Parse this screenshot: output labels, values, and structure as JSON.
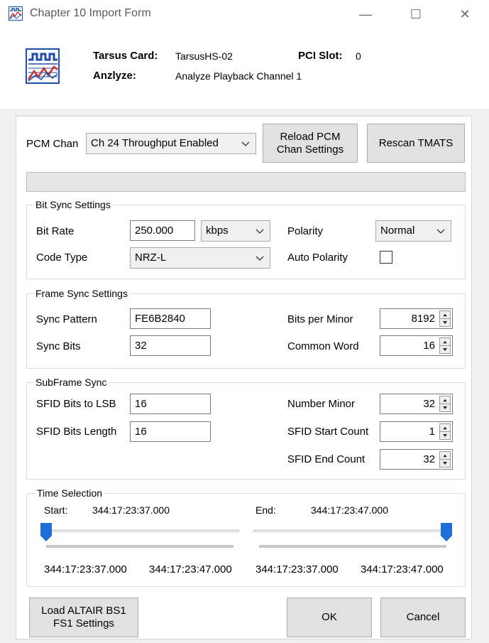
{
  "window": {
    "title": "Chapter 10 Import Form",
    "minimize_glyph": "—",
    "maximize_glyph": "☐",
    "close_glyph": "✕"
  },
  "header": {
    "card_label": "Tarsus Card:",
    "card_value": "TarsusHS-02",
    "pci_label": "PCI Slot:",
    "pci_value": "0",
    "analyze_label": "Anzlyze:",
    "analyze_value": "Analyze Playback Channel 1"
  },
  "pcm": {
    "chan_label": "PCM Chan",
    "chan_value": "Ch 24 Throughput Enabled",
    "reload_line1": "Reload PCM",
    "reload_line2": "Chan Settings",
    "rescan_label": "Rescan TMATS"
  },
  "bit_sync": {
    "title": "Bit Sync Settings",
    "bit_rate_label": "Bit Rate",
    "bit_rate_value": "250.000",
    "bit_rate_unit": "kbps",
    "polarity_label": "Polarity",
    "polarity_value": "Normal",
    "code_type_label": "Code Type",
    "code_type_value": "NRZ-L",
    "auto_polarity_label": "Auto Polarity",
    "auto_polarity_checked": false
  },
  "frame_sync": {
    "title": "Frame Sync Settings",
    "sync_pattern_label": "Sync Pattern",
    "sync_pattern_value": "FE6B2840",
    "sync_bits_label": "Sync Bits",
    "sync_bits_value": "32",
    "bits_per_minor_label": "Bits per Minor",
    "bits_per_minor_value": "8192",
    "common_word_label": "Common Word",
    "common_word_value": "16"
  },
  "subframe_sync": {
    "title": "SubFrame Sync",
    "sfid_lsb_label": "SFID Bits to LSB",
    "sfid_lsb_value": "16",
    "sfid_length_label": "SFID Bits Length",
    "sfid_length_value": "16",
    "number_minor_label": "Number Minor",
    "number_minor_value": "32",
    "sfid_start_label": "SFID Start Count",
    "sfid_start_value": "1",
    "sfid_end_label": "SFID End Count",
    "sfid_end_value": "32"
  },
  "time_selection": {
    "title": "Time Selection",
    "start_label": "Start:",
    "start_value": "344:17:23:37.000",
    "end_label": "End:",
    "end_value": "344:17:23:47.000",
    "start_slider_fraction": 0.0,
    "end_slider_fraction": 1.0,
    "start_min": "344:17:23:37.000",
    "start_max": "344:17:23:47.000",
    "end_min": "344:17:23:37.000",
    "end_max": "344:17:23:47.000"
  },
  "footer": {
    "load_line1": "Load ALTAIR BS1",
    "load_line2": "FS1 Settings",
    "ok_label": "OK",
    "cancel_label": "Cancel"
  },
  "colors": {
    "slider_thumb": "#1e6fd9",
    "icon_blue": "#1f4ea8",
    "icon_red": "#c8312e"
  }
}
